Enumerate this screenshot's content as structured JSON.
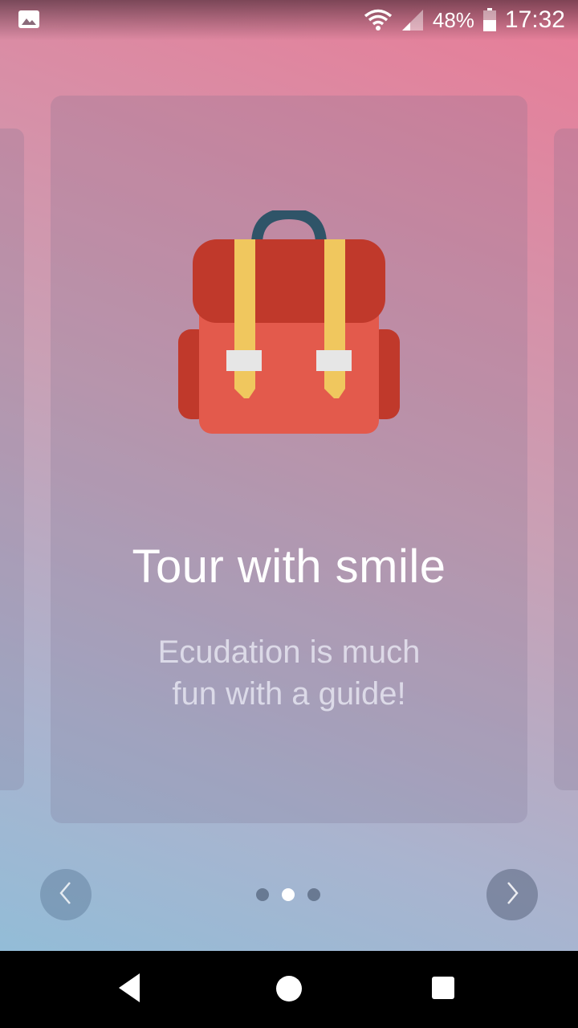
{
  "status_bar": {
    "battery_percent": "48%",
    "time": "17:32",
    "icons": [
      "image-icon",
      "wifi-icon",
      "signal-icon",
      "battery-icon"
    ]
  },
  "slide": {
    "title": "Tour with smile",
    "subtitle_line1": "Ecudation is much",
    "subtitle_line2": "fun with a guide!",
    "illustration": "backpack-icon"
  },
  "pager": {
    "total": 3,
    "active_index": 1
  },
  "navigation": {
    "prev_icon": "chevron-left-icon",
    "next_icon": "chevron-right-icon"
  },
  "system_nav": {
    "icons": [
      "back-icon",
      "home-icon",
      "recents-icon"
    ]
  },
  "colors": {
    "backpack_body": "#e35a4c",
    "backpack_flap": "#c0392b",
    "backpack_straps": "#f0c75e",
    "backpack_handle": "#2f5468",
    "buckle": "#e6e6e6"
  }
}
